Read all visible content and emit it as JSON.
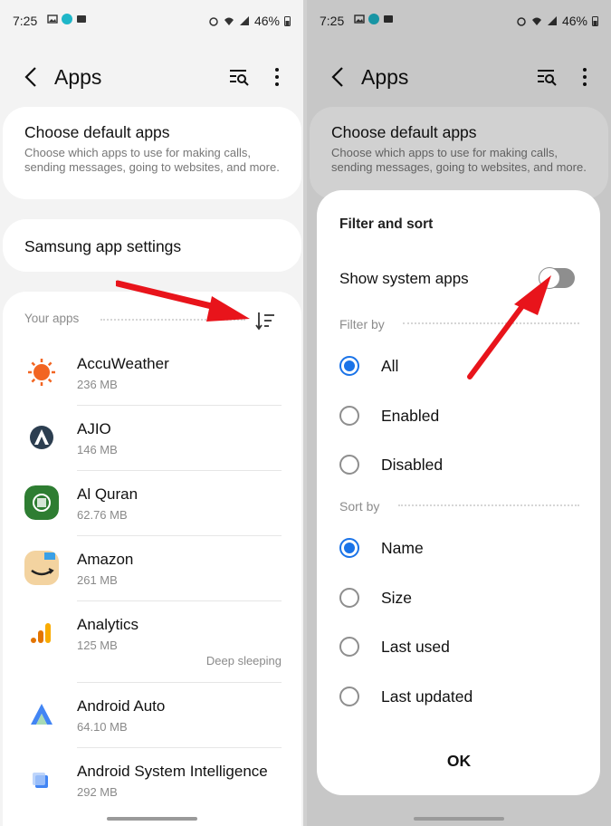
{
  "status": {
    "time": "7:25",
    "battery": "46%"
  },
  "left": {
    "title": "Apps",
    "default_apps": {
      "title": "Choose default apps",
      "subtitle": "Choose which apps to use for making calls, sending messages, going to websites, and more."
    },
    "samsung_settings": "Samsung app settings",
    "your_apps_label": "Your apps",
    "apps": [
      {
        "name": "AccuWeather",
        "size": "236 MB",
        "status": "",
        "icon": "accuweather-icon",
        "color": "#f26522"
      },
      {
        "name": "AJIO",
        "size": "146 MB",
        "status": "",
        "icon": "ajio-icon",
        "color": "#2c3e50"
      },
      {
        "name": "Al Quran",
        "size": "62.76 MB",
        "status": "",
        "icon": "al-quran-icon",
        "color": "#2e7d32"
      },
      {
        "name": "Amazon",
        "size": "261 MB",
        "status": "",
        "icon": "amazon-icon",
        "color": "#f3d3a0"
      },
      {
        "name": "Analytics",
        "size": "125 MB",
        "status": "Deep sleeping",
        "icon": "analytics-icon",
        "color": "#f9ab00"
      },
      {
        "name": "Android Auto",
        "size": "64.10 MB",
        "status": "",
        "icon": "android-auto-icon",
        "color": "#4285f4"
      },
      {
        "name": "Android System Intelligence",
        "size": "292 MB",
        "status": "",
        "icon": "android-system-intelligence-icon",
        "color": "#4285f4"
      }
    ]
  },
  "right": {
    "title": "Apps",
    "default_apps": {
      "title": "Choose default apps",
      "subtitle": "Choose which apps to use for making calls, sending messages, going to websites, and more."
    },
    "sheet": {
      "title": "Filter and sort",
      "toggle_label": "Show system apps",
      "filter_label": "Filter by",
      "filter_options": [
        {
          "label": "All",
          "selected": true
        },
        {
          "label": "Enabled",
          "selected": false
        },
        {
          "label": "Disabled",
          "selected": false
        }
      ],
      "sort_label": "Sort by",
      "sort_options": [
        {
          "label": "Name",
          "selected": true
        },
        {
          "label": "Size",
          "selected": false
        },
        {
          "label": "Last used",
          "selected": false
        },
        {
          "label": "Last updated",
          "selected": false
        }
      ],
      "ok_label": "OK"
    }
  },
  "colors": {
    "accent": "#1a73e8",
    "arrow": "#e8141b"
  }
}
